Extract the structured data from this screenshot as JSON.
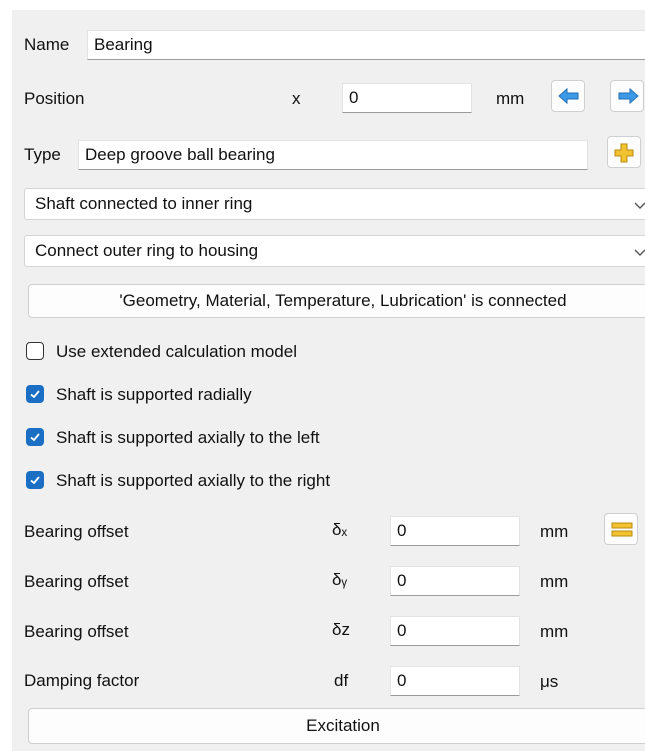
{
  "name": {
    "label": "Name",
    "value": "Bearing"
  },
  "position": {
    "label": "Position",
    "symbol": "x",
    "value": "0",
    "unit": "mm"
  },
  "type": {
    "label": "Type",
    "value": "Deep groove ball bearing"
  },
  "inner_connection": {
    "selected": "Shaft connected to inner ring"
  },
  "outer_connection": {
    "selected": "Connect outer ring to housing"
  },
  "connected_button": {
    "label": "'Geometry, Material, Temperature, Lubrication' is connected"
  },
  "checkboxes": [
    {
      "label": "Use extended calculation model",
      "checked": false
    },
    {
      "label": "Shaft is supported radially",
      "checked": true
    },
    {
      "label": "Shaft is supported axially to the left",
      "checked": true
    },
    {
      "label": "Shaft is supported axially to the right",
      "checked": true
    }
  ],
  "offsets": [
    {
      "label": "Bearing offset",
      "symbol": "δₓ",
      "value": "0",
      "unit": "mm"
    },
    {
      "label": "Bearing offset",
      "symbol": "δᵧ",
      "value": "0",
      "unit": "mm"
    },
    {
      "label": "Bearing offset",
      "symbol": "δz",
      "value": "0",
      "unit": "mm"
    }
  ],
  "damping": {
    "label": "Damping factor",
    "symbol": "df",
    "value": "0",
    "unit": "μs"
  },
  "excitation_button": {
    "label": "Excitation"
  },
  "colors": {
    "accent": "#1a6fc4",
    "arrow_blue": "#3c9ae8",
    "plus_yellow": "#f2c230"
  }
}
